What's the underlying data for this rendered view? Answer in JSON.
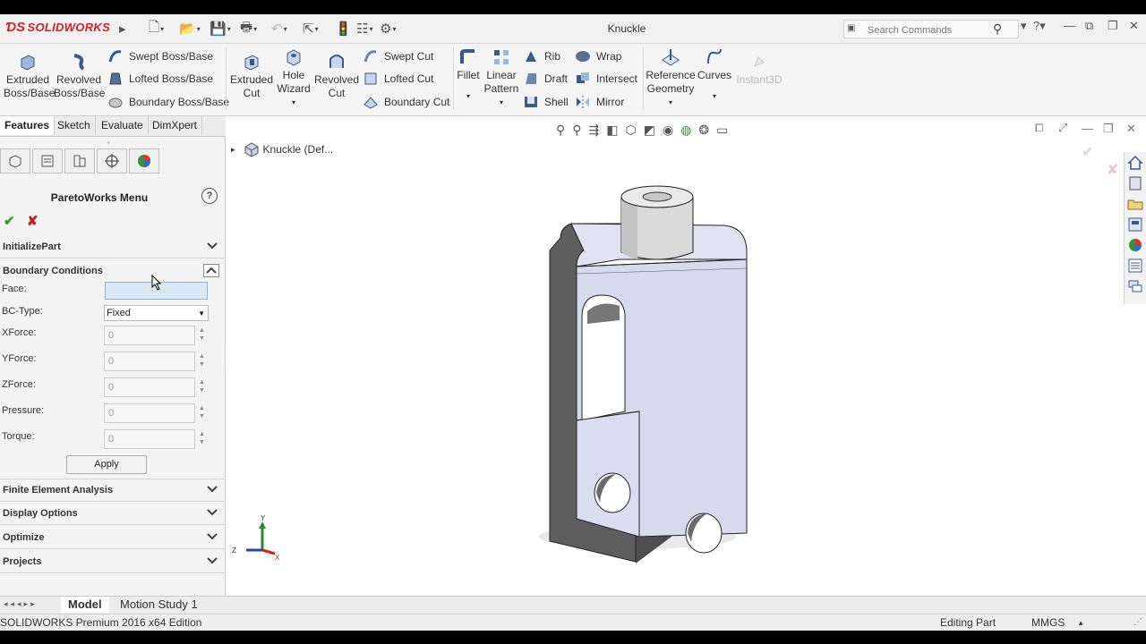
{
  "app": {
    "logo": "SOLIDWORKS",
    "document_title": "Knuckle"
  },
  "search": {
    "placeholder": "Search Commands"
  },
  "ribbon": {
    "extruded_boss": "Extruded Boss/Base",
    "revolved_boss": "Revolved Boss/Base",
    "swept_boss": "Swept Boss/Base",
    "lofted_boss": "Lofted Boss/Base",
    "boundary_boss": "Boundary Boss/Base",
    "extruded_cut": "Extruded Cut",
    "hole_wizard": "Hole Wizard",
    "revolved_cut": "Revolved Cut",
    "swept_cut": "Swept Cut",
    "lofted_cut": "Lofted Cut",
    "boundary_cut": "Boundary Cut",
    "fillet": "Fillet",
    "linear_pattern": "Linear Pattern",
    "rib": "Rib",
    "draft": "Draft",
    "shell": "Shell",
    "wrap": "Wrap",
    "intersect": "Intersect",
    "mirror": "Mirror",
    "reference_geometry": "Reference Geometry",
    "curves": "Curves",
    "instant3d": "Instant3D"
  },
  "feature_tabs": [
    "Features",
    "Sketch",
    "Evaluate",
    "DimXpert"
  ],
  "pareto": {
    "title": "ParetoWorks Menu",
    "help": "?",
    "initialize": "InitializePart",
    "boundary_conditions": "Boundary Conditions",
    "face_label": "Face:",
    "face_value": "",
    "bc_type_label": "BC-Type:",
    "bc_type_value": "Fixed",
    "xforce_label": "XForce:",
    "xforce_value": "0",
    "yforce_label": "YForce:",
    "yforce_value": "0",
    "zforce_label": "ZForce:",
    "zforce_value": "0",
    "pressure_label": "Pressure:",
    "pressure_value": "0",
    "torque_label": "Torque:",
    "torque_value": "0",
    "apply": "Apply",
    "fea": "Finite Element Analysis",
    "display_options": "Display Options",
    "optimize": "Optimize",
    "projects": "Projects"
  },
  "tree": {
    "root": "Knuckle  (Def..."
  },
  "triad": {
    "x": "X",
    "y": "Y",
    "z": "Z"
  },
  "bottom_tabs": [
    "Model",
    "Motion Study 1"
  ],
  "status": {
    "edition": "SOLIDWORKS Premium 2016 x64 Edition",
    "mode": "Editing Part",
    "units": "MMGS"
  },
  "colors": {
    "accent": "#d31f26",
    "part_face": "#dcdcf0",
    "part_side": "#5a5a5a"
  }
}
